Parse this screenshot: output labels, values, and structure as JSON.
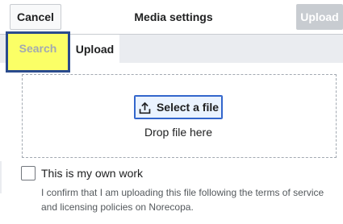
{
  "header": {
    "cancel_label": "Cancel",
    "title": "Media settings",
    "upload_label": "Upload"
  },
  "tabs": [
    {
      "label": "Search",
      "highlighted": true
    },
    {
      "label": "Upload",
      "selected": true
    }
  ],
  "dropzone": {
    "select_label": "Select a file",
    "select_icon": "upload-icon",
    "drop_text": "Drop file here"
  },
  "own_work": {
    "checked": false,
    "label": "This is my own work",
    "help": "I confirm that I am uploading this file following the terms of service and licensing policies on Norecopa."
  },
  "colors": {
    "accent": "#3366cc",
    "highlight": "#fbff66",
    "disabled": "#c8ccd1"
  }
}
